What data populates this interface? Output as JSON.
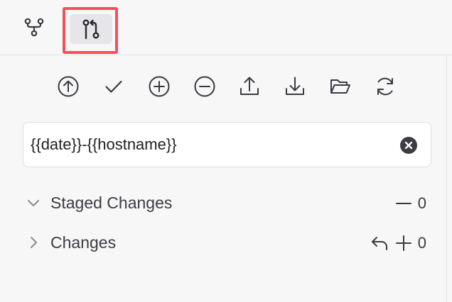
{
  "tabs": [
    {
      "icon": "graph-icon",
      "selected": false
    },
    {
      "icon": "source-control-icon",
      "selected": true
    }
  ],
  "toolbar": {
    "buttons": [
      {
        "icon": "arrow-up-circle-icon"
      },
      {
        "icon": "check-icon"
      },
      {
        "icon": "plus-circle-icon"
      },
      {
        "icon": "minus-circle-icon"
      },
      {
        "icon": "upload-icon"
      },
      {
        "icon": "download-icon"
      },
      {
        "icon": "folder-open-icon"
      },
      {
        "icon": "refresh-icon"
      }
    ]
  },
  "commit_message": {
    "value": "{{date}}-{{hostname}}",
    "clear_icon": "clear-circle-icon"
  },
  "sections": {
    "staged": {
      "label": "Staged Changes",
      "expanded": true,
      "count": "0",
      "actions": [
        "minus-icon"
      ]
    },
    "changes": {
      "label": "Changes",
      "expanded": false,
      "count": "0",
      "actions": [
        "undo-icon",
        "plus-icon"
      ]
    }
  },
  "colors": {
    "highlight_border": "#f4505c",
    "icon": "#3a3b41",
    "background": "#f7f7f8"
  }
}
